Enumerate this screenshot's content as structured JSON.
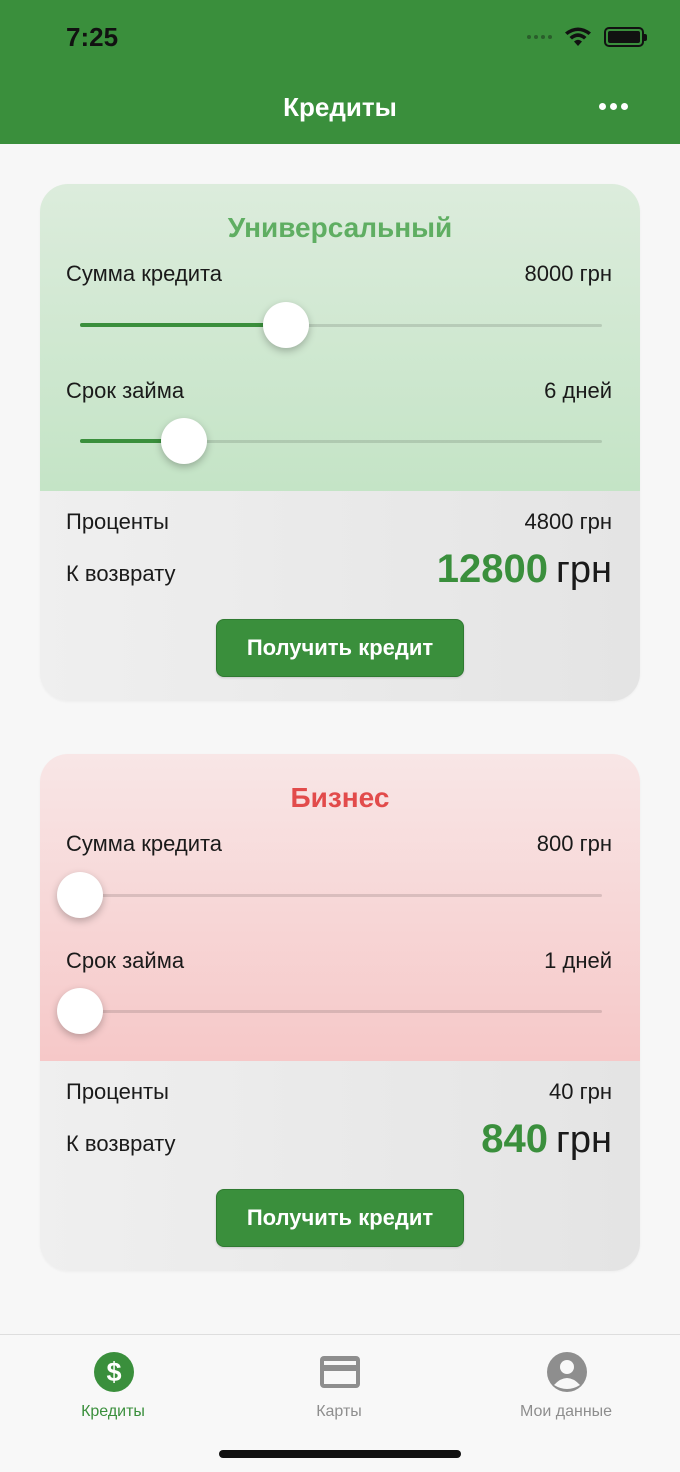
{
  "status_bar": {
    "time": "7:25"
  },
  "nav": {
    "title": "Кредиты",
    "more_icon": "ellipsis-icon"
  },
  "colors": {
    "brand": "#3a8f3c",
    "universal_title": "#5fae62",
    "business_title": "#e24b4b"
  },
  "cards": [
    {
      "title": "Универсальный",
      "amount": {
        "label": "Сумма кредита",
        "value": "8000 грн",
        "slider_fraction": 0.394
      },
      "term": {
        "label": "Срок займа",
        "value": "6 дней",
        "slider_fraction": 0.2
      },
      "interest": {
        "label": "Проценты",
        "value": "4800 грн"
      },
      "total": {
        "label": "К возврату",
        "amount": "12800",
        "currency": "грн"
      },
      "button": "Получить кредит"
    },
    {
      "title": "Бизнес",
      "amount": {
        "label": "Сумма кредита",
        "value": "800 грн",
        "slider_fraction": 0.0
      },
      "term": {
        "label": "Срок займа",
        "value": "1 дней",
        "slider_fraction": 0.0
      },
      "interest": {
        "label": "Проценты",
        "value": "40 грн"
      },
      "total": {
        "label": "К возврату",
        "amount": "840",
        "currency": "грн"
      },
      "button": "Получить кредит"
    }
  ],
  "tabbar": {
    "tabs": [
      {
        "label": "Кредиты",
        "icon": "dollar-icon",
        "active": true
      },
      {
        "label": "Карты",
        "icon": "credit-card-icon",
        "active": false
      },
      {
        "label": "Мои данные",
        "icon": "user-icon",
        "active": false
      }
    ]
  }
}
